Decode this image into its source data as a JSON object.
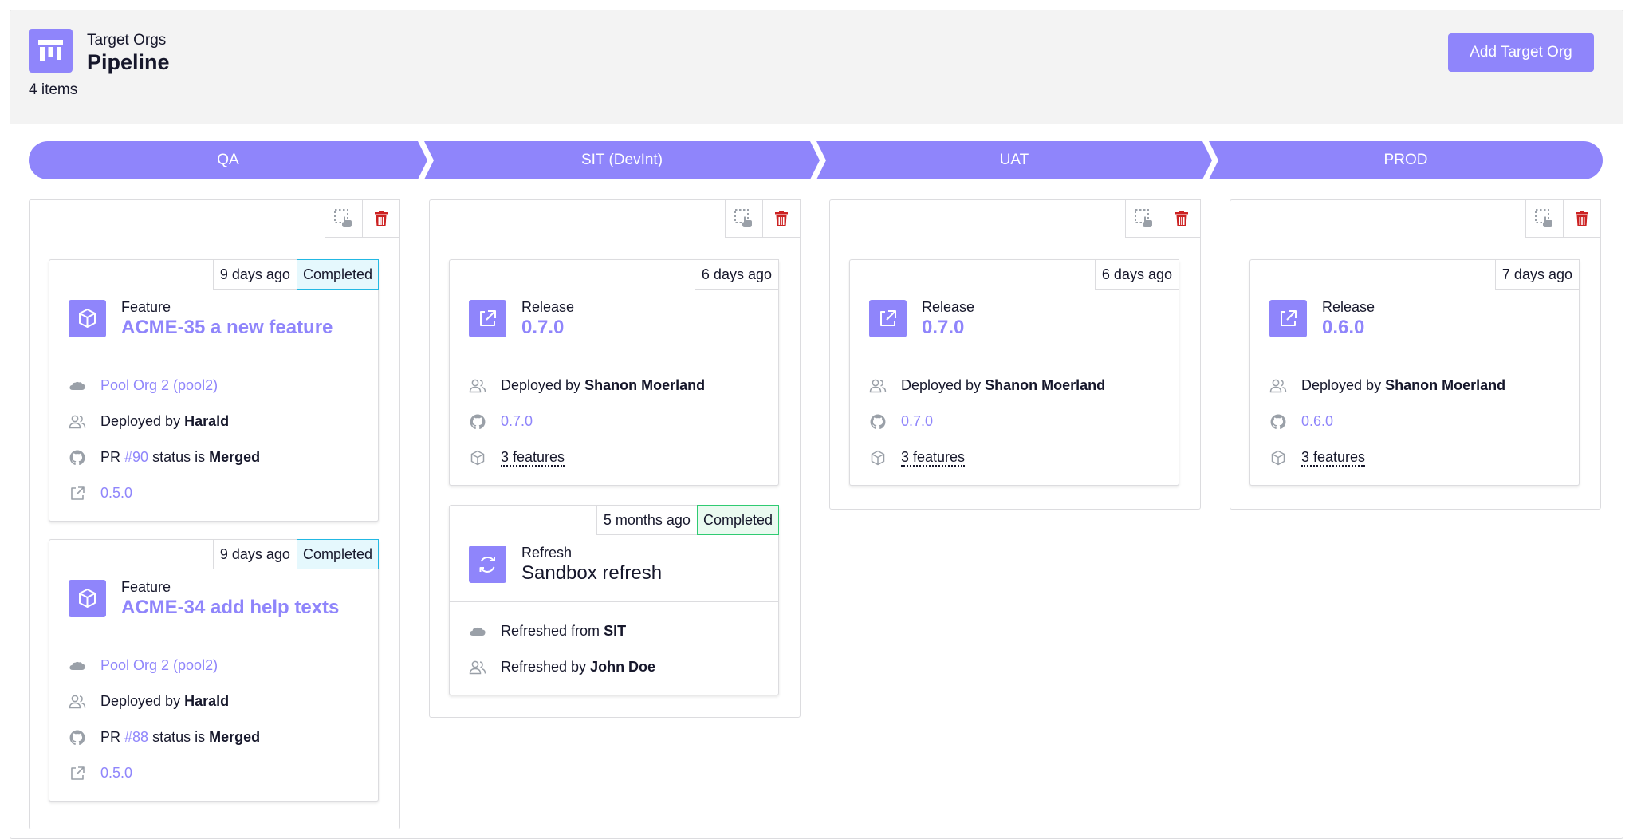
{
  "header": {
    "subtitle": "Target Orgs",
    "title": "Pipeline",
    "count": "4 items",
    "add_button": "Add Target Org"
  },
  "stages": [
    "QA",
    "SIT (DevInt)",
    "UAT",
    "PROD"
  ],
  "colors": {
    "accent": "#8f85fb",
    "completed_blue": "#22b8e3",
    "completed_green": "#2fcb72",
    "danger": "#cc2222"
  },
  "columns": [
    {
      "cards": [
        {
          "time": "9 days ago",
          "status": "Completed",
          "type": "Feature",
          "title": "ACME-35 a new feature",
          "org": "Pool Org 2 (pool2)",
          "deployed_prefix": "Deployed by ",
          "deployed_by": "Harald",
          "pr_prefix": "PR ",
          "pr_number": "#90",
          "pr_mid": " status is ",
          "pr_status": "Merged",
          "version": "0.5.0"
        },
        {
          "time": "9 days ago",
          "status": "Completed",
          "type": "Feature",
          "title": "ACME-34 add help texts",
          "org": "Pool Org 2 (pool2)",
          "deployed_prefix": "Deployed by ",
          "deployed_by": "Harald",
          "pr_prefix": "PR ",
          "pr_number": "#88",
          "pr_mid": " status is ",
          "pr_status": "Merged",
          "version": "0.5.0"
        }
      ]
    },
    {
      "cards": [
        {
          "time": "6 days ago",
          "type": "Release",
          "title": "0.7.0",
          "deployed_prefix": "Deployed by ",
          "deployed_by": "Shanon Moerland",
          "version": "0.7.0",
          "features": "3 features"
        },
        {
          "time": "5 months ago",
          "status": "Completed",
          "type": "Refresh",
          "title": "Sandbox refresh",
          "refreshed_from_prefix": "Refreshed from ",
          "refreshed_from": "SIT",
          "refreshed_by_prefix": "Refreshed by ",
          "refreshed_by": "John Doe"
        }
      ]
    },
    {
      "cards": [
        {
          "time": "6 days ago",
          "type": "Release",
          "title": "0.7.0",
          "deployed_prefix": "Deployed by ",
          "deployed_by": "Shanon Moerland",
          "version": "0.7.0",
          "features": "3 features"
        }
      ]
    },
    {
      "cards": [
        {
          "time": "7 days ago",
          "type": "Release",
          "title": "0.6.0",
          "deployed_prefix": "Deployed by ",
          "deployed_by": "Shanon Moerland",
          "version": "0.6.0",
          "features": "3 features"
        }
      ]
    }
  ]
}
